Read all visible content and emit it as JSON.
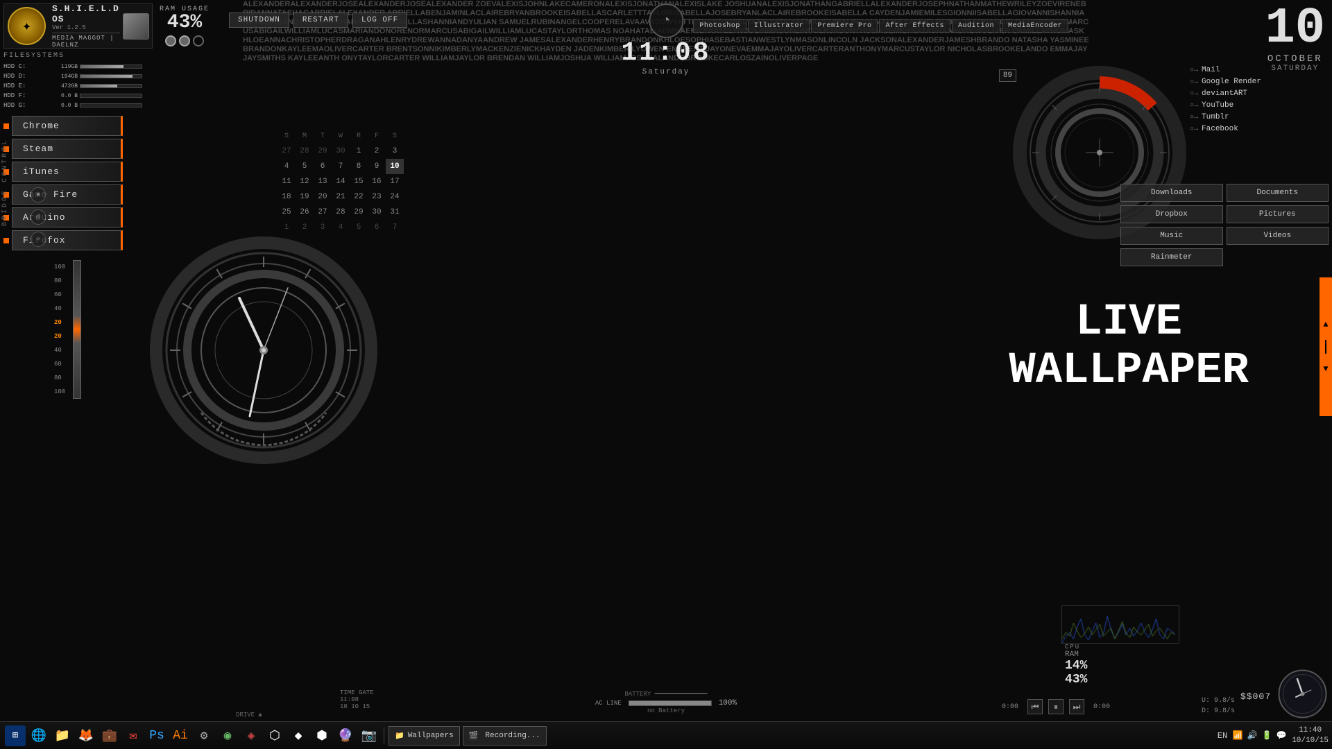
{
  "os": {
    "name": "S.H.I.E.L.D OS",
    "version": "Ver 1.2.5",
    "user1": "MEDIA MAGGOT",
    "user2": "DAELNZ"
  },
  "ram": {
    "label": "RAM USAGE",
    "value": "43%"
  },
  "controls": {
    "shutdown": "SHUTDOWN",
    "restart": "RESTART",
    "logoff": "LOG OFF"
  },
  "clock": {
    "time": "11:08",
    "day": "Saturday"
  },
  "date": {
    "number": "10",
    "month": "OCTOBER",
    "weekday": "SATURDAY"
  },
  "apps": [
    {
      "name": "Chrome"
    },
    {
      "name": "Steam"
    },
    {
      "name": "iTunes"
    },
    {
      "name": "Game Fire"
    },
    {
      "name": "Arduino"
    },
    {
      "name": "Firefox"
    }
  ],
  "filesystem": {
    "title": "FILESYSTEMS",
    "items": [
      {
        "label": "HDD C:",
        "used": "119GB",
        "fill": 70
      },
      {
        "label": "HDD D:",
        "used": "194GB",
        "fill": 85
      },
      {
        "label": "HDD E:",
        "used": "472GB",
        "fill": 60
      },
      {
        "label": "HDD F:",
        "used": "0.0 B",
        "fill": 0
      },
      {
        "label": "HDD G:",
        "used": "0.0 B",
        "fill": 0
      }
    ]
  },
  "calendar": {
    "headers": [
      "S",
      "M",
      "T",
      "W",
      "R",
      "F",
      "S"
    ],
    "rows": [
      [
        "27",
        "28",
        "29",
        "30",
        "1",
        "2",
        "3"
      ],
      [
        "4",
        "5",
        "6",
        "7",
        "8",
        "9",
        "10"
      ],
      [
        "11",
        "12",
        "13",
        "14",
        "15",
        "16",
        "17"
      ],
      [
        "18",
        "19",
        "20",
        "21",
        "22",
        "23",
        "24"
      ],
      [
        "25",
        "26",
        "27",
        "28",
        "29",
        "30",
        "31"
      ],
      [
        "1",
        "2",
        "3",
        "4",
        "5",
        "6",
        "7"
      ]
    ],
    "today": "10"
  },
  "rightShortcuts": [
    {
      "name": "Mail",
      "arrow": "○→"
    },
    {
      "name": "Google Render",
      "arrow": "○→"
    },
    {
      "name": "deviantART",
      "arrow": "○→"
    },
    {
      "name": "YouTube",
      "arrow": "○→"
    },
    {
      "name": "Tumblr",
      "arrow": "○→"
    },
    {
      "name": "Facebook",
      "arrow": "○→"
    }
  ],
  "folderShortcuts": [
    "Downloads",
    "Documents",
    "Dropbox",
    "Pictures",
    "Music",
    "Videos",
    "Rainmeter",
    ""
  ],
  "appShortcuts": [
    "Photoshop",
    "Illustrator",
    "Premiere Pro",
    "After Effects",
    "Audition",
    "MediaEncoder"
  ],
  "liveWallpaper": {
    "line1": "LIVE",
    "line2": "WALLPAPER"
  },
  "cpu": {
    "label": "CPU",
    "ram_value": "14%",
    "cpu_value": "43%"
  },
  "networkSpeed": {
    "upload_label": "U:",
    "upload_value": "9.8/s",
    "download_label": "D:",
    "download_value": "9.8/s"
  },
  "battery": {
    "percentage": "100%",
    "status": "AC LINE",
    "substatus": "no Battery"
  },
  "taskbar": {
    "startLabel": "⊞",
    "items": [
      "Wallpapers",
      "Recording..."
    ],
    "time": "11:40",
    "date": "10/10/15",
    "lang": "EN",
    "ssLabel": "$$007"
  },
  "gauge": {
    "value": "89"
  },
  "mediaPlayer": {
    "prev": "⏮",
    "play": "⏸",
    "next": "⏭"
  },
  "bridge": "BRIDGE CONTROL",
  "barChart": {
    "topLabels": [
      "100",
      "80",
      "60",
      "40",
      "20"
    ],
    "bottomLabels": [
      "20",
      "40",
      "60",
      "80",
      "100"
    ]
  },
  "bottomInfo": {
    "drive": "DRIVE ▲",
    "timeGate": "TIME GATE",
    "time": "11:08",
    "date": "10 10 15"
  }
}
